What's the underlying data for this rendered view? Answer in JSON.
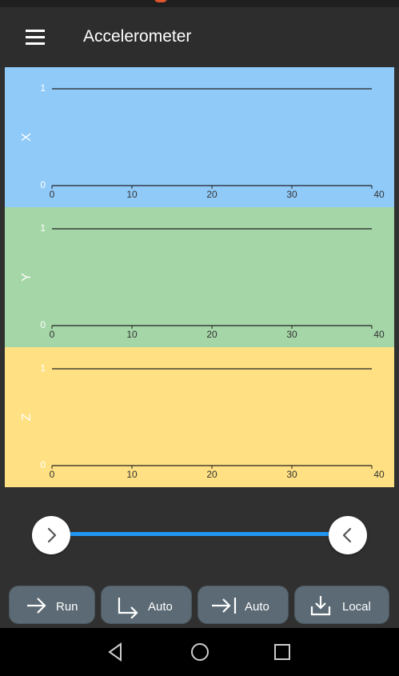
{
  "app": {
    "title": "Accelerometer"
  },
  "charts": [
    {
      "axis_label": "X",
      "bg": "#90caf9",
      "y_ticks": [
        "1",
        "0"
      ],
      "x_ticks": [
        "0",
        "10",
        "20",
        "30",
        "40"
      ]
    },
    {
      "axis_label": "Y",
      "bg": "#a5d6a7",
      "y_ticks": [
        "1",
        "0"
      ],
      "x_ticks": [
        "0",
        "10",
        "20",
        "30",
        "40"
      ]
    },
    {
      "axis_label": "Z",
      "bg": "#ffe082",
      "y_ticks": [
        "1",
        "0"
      ],
      "x_ticks": [
        "0",
        "10",
        "20",
        "30",
        "40"
      ]
    }
  ],
  "range_slider": {
    "start": 0,
    "end": 1,
    "accent": "#2196f3"
  },
  "buttons": [
    {
      "label": "Run",
      "icon": "arrow-right-icon"
    },
    {
      "label": "Auto",
      "icon": "arrow-down-right-icon"
    },
    {
      "label": "Auto",
      "icon": "arrow-to-bar-icon"
    },
    {
      "label": "Local",
      "icon": "download-tray-icon"
    }
  ],
  "navigation": {
    "back": "back-icon",
    "home": "home-icon",
    "recents": "recents-icon"
  }
}
